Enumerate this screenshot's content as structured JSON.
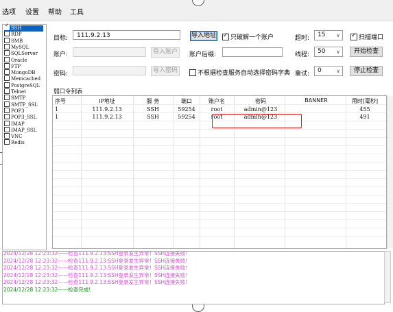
{
  "menu": [
    "选项",
    "设置",
    "帮助",
    "工具"
  ],
  "protocols": [
    {
      "label": "SSH",
      "checked": true,
      "selected": true
    },
    {
      "label": "RDP",
      "checked": false
    },
    {
      "label": "SMB",
      "checked": false
    },
    {
      "label": "MySQL",
      "checked": false
    },
    {
      "label": "SQLServer",
      "checked": false
    },
    {
      "label": "Oracle",
      "checked": false
    },
    {
      "label": "FTP",
      "checked": false
    },
    {
      "label": "MongoDB",
      "checked": false
    },
    {
      "label": "Memcached",
      "checked": false
    },
    {
      "label": "PostgreSQL",
      "checked": false
    },
    {
      "label": "Telnet",
      "checked": false
    },
    {
      "label": "SMTP",
      "checked": false
    },
    {
      "label": "SMTP_SSL",
      "checked": false
    },
    {
      "label": "POP3",
      "checked": false
    },
    {
      "label": "POP3_SSL",
      "checked": false
    },
    {
      "label": "IMAP",
      "checked": false
    },
    {
      "label": "IMAP_SSL",
      "checked": false
    },
    {
      "label": "VNC",
      "checked": false
    },
    {
      "label": "Redis",
      "checked": false
    }
  ],
  "form": {
    "target_label": "目标:",
    "target_value": "111.9.2.13",
    "import_addr_btn": "导入地址",
    "crack_one_label": "只破解一个账户",
    "crack_one_checked": true,
    "timeout_label": "超时:",
    "timeout_value": "15",
    "scan_port_label": "扫描端口",
    "scan_port_checked": true,
    "account_label": "账户:",
    "import_account_btn": "导入账户",
    "account_suffix_label": "账户后缀:",
    "threads_label": "线程:",
    "threads_value": "50",
    "start_btn": "开始检查",
    "password_label": "密码:",
    "import_password_btn": "导入密码",
    "auto_dict_label": "不根据检查服务自动选择密码字典",
    "auto_dict_checked": false,
    "retry_label": "重试:",
    "retry_value": "0",
    "stop_btn": "停止检查"
  },
  "weak_list": {
    "title": "弱口令列表",
    "columns": [
      "序号",
      "IP地址",
      "服 务",
      "端口",
      "账户名",
      "密码",
      "BANNER",
      "用时[毫秒]"
    ],
    "rows": [
      [
        "1",
        "111.9.2.13",
        "SSH",
        "59254",
        "root",
        "admin@123",
        "",
        "455"
      ],
      [
        "1",
        "111.9.2.13",
        "SSH",
        "59254",
        "root",
        "admin@123",
        "",
        "491"
      ]
    ]
  },
  "log": {
    "lines": [
      {
        "text": "2024/12/28 12:23:32——检查111.9.2.13:SSH登录发生异常！SSH连接失败!",
        "color": "#d84fd8"
      },
      {
        "text": "2024/12/28 12:23:32——检查111.9.2.13:SSH登录发生异常！SSH连接失败!",
        "color": "#d84fd8"
      },
      {
        "text": "2024/12/28 12:23:32——检查111.9.2.13:SSH登录发生异常！SSH连接失败!",
        "color": "#d84fd8"
      },
      {
        "text": "2024/12/28 12:23:32——检查111.9.2.13:SSH登录发生异常！SSH连接失败!",
        "color": "#d84fd8"
      },
      {
        "text": "2024/12/28 12:23:32——检查111.9.2.13:SSH登录发生异常！SSH连接失败!",
        "color": "#d84fd8"
      },
      {
        "text": "2024/12/28 12:23:32——检查完成!",
        "color": "#1a8a1a"
      }
    ]
  }
}
